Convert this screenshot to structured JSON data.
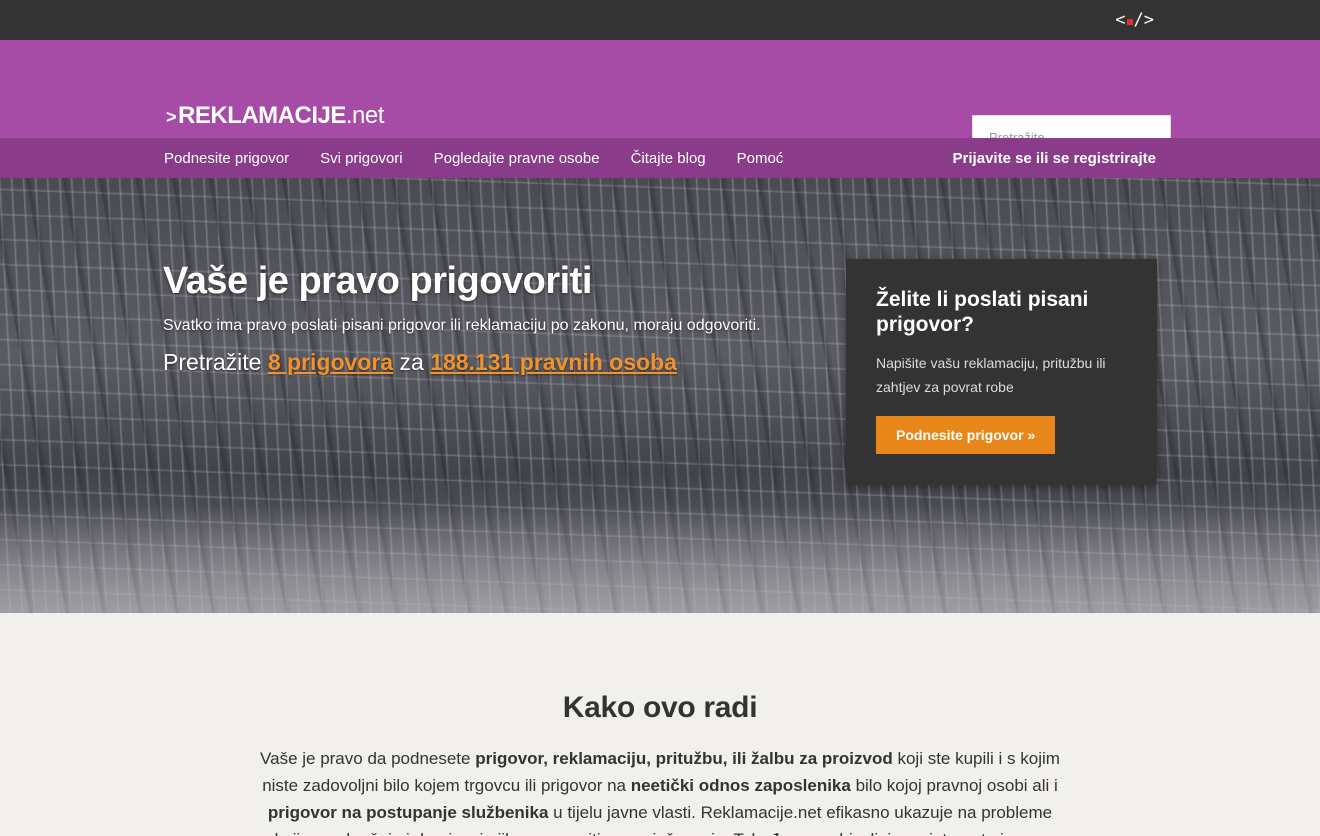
{
  "topbar": {
    "code_logo_left": "<",
    "code_logo_right": "/>"
  },
  "header": {
    "logo_caret": ">",
    "logo_main": "REKLAMACIJE",
    "logo_suffix": ".net",
    "search_placeholder": "Pretražite"
  },
  "nav": {
    "items": [
      {
        "label": "Podnesite prigovor"
      },
      {
        "label": "Svi prigovori"
      },
      {
        "label": "Pogledajte pravne osobe"
      },
      {
        "label": "Čitajte blog"
      },
      {
        "label": "Pomoć"
      }
    ],
    "login": "Prijavite se ili se registrirajte"
  },
  "hero": {
    "title": "Vaše je pravo prigovoriti",
    "subtitle": "Svatko ima pravo poslati pisani prigovor ili reklamaciju po zakonu, moraju odgovoriti.",
    "search_prefix": "Pretražite ",
    "complaints_link": "8 prigovora",
    "search_mid": " za ",
    "entities_link": "188.131 pravnih osoba"
  },
  "cta": {
    "title": "Želite li poslati pisani prigovor?",
    "text": "Napišite vašu reklamaciju, pritužbu ili zahtjev za povrat robe",
    "button": "Podnesite prigovor »"
  },
  "how": {
    "heading": "Kako ovo radi",
    "p1": "Vaše je pravo da podnesete ",
    "b1": "prigovor, reklamaciju, pritužbu, ili žalbu za proizvod",
    "p2": " koji ste kupili i s kojim niste zadovoljni bilo kojem trgovcu ili prigovor na ",
    "b2": "neetički odnos zaposlenika",
    "p3": " bilo kojoj pravnoj osobi ali i ",
    "b3": "prigovor na postupanje službenika",
    "p4": " u tijelu javne vlasti. Reklamacije.net efikasno ukazuje na probleme koji nas okružuju i doprinosi njihovom pozitivnom rješavanju. Također sve objavljuje na internetu javno."
  },
  "colors": {
    "topbar": "#333333",
    "header": "#a64ca6",
    "nav": "#8a3b8a",
    "accent": "#e8861a",
    "link": "#f0932b",
    "page_bg": "#f2f0ec"
  }
}
